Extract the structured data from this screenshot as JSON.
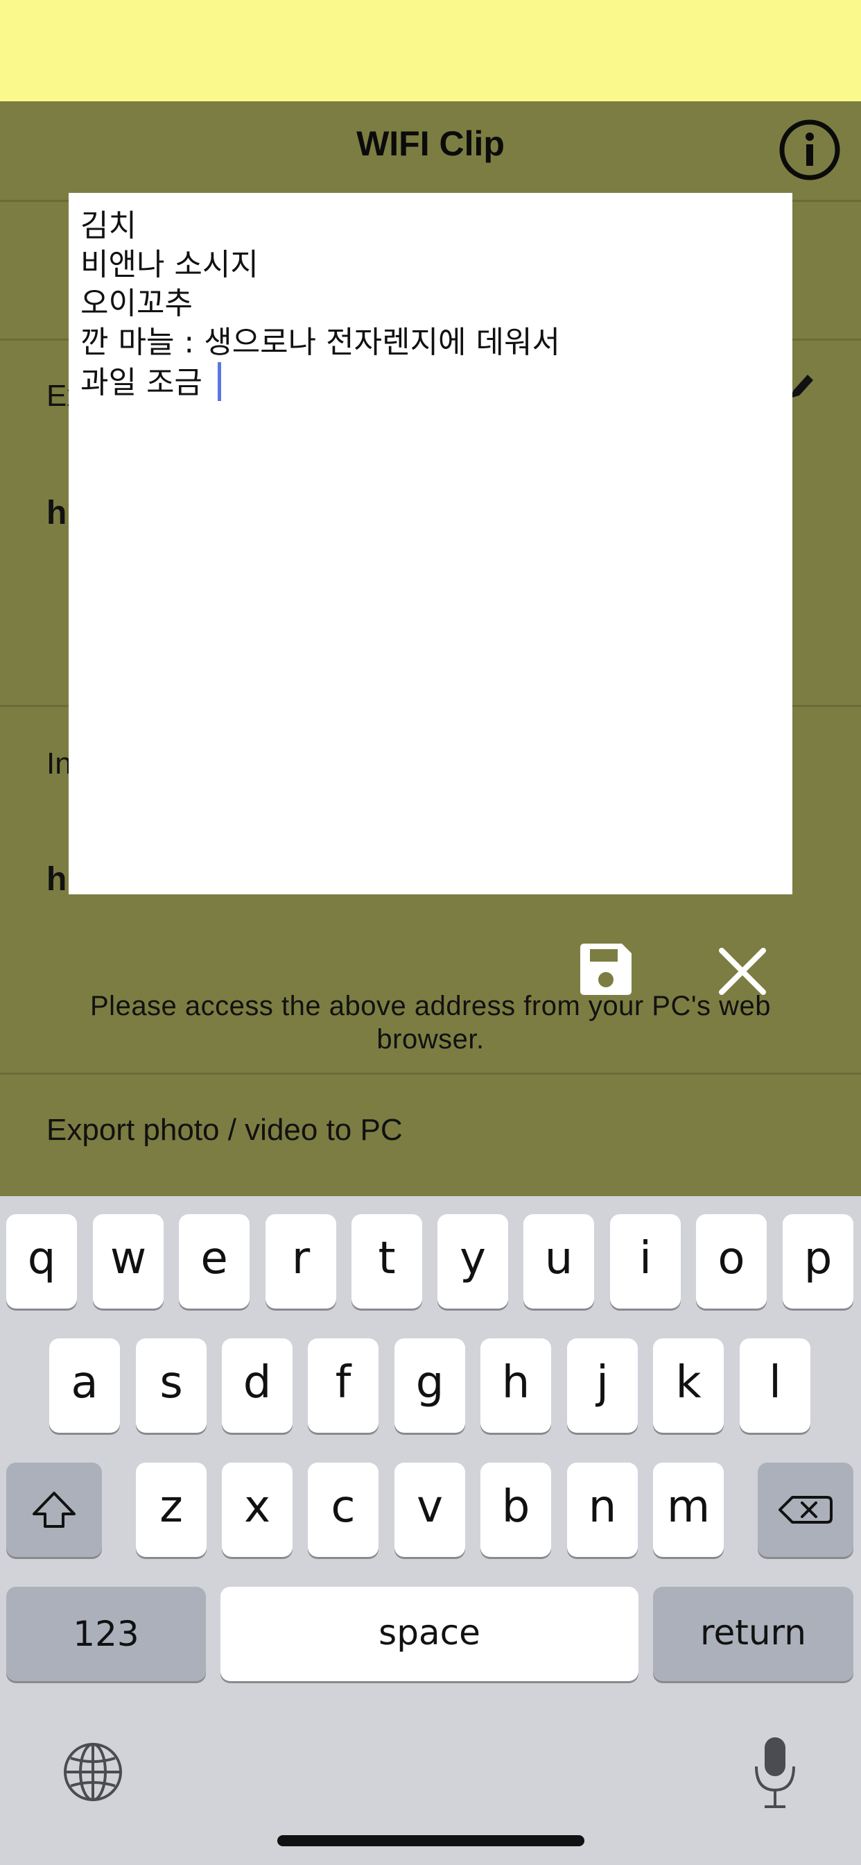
{
  "header": {
    "title": "WIFI Clip"
  },
  "background": {
    "export_label_partial": "Ex",
    "url1_partial": "h",
    "import_label_partial": "In",
    "url2_partial": "h",
    "help_text": "Please access the above address from your PC's web browser.",
    "export_media_label": "Export photo / video to PC"
  },
  "editor": {
    "lines": [
      "김치",
      "비앤나 소시지",
      "오이꼬추",
      "깐 마늘 : 생으로나 전자렌지에 데워서",
      "과일 조금 "
    ]
  },
  "keyboard": {
    "row1": [
      "q",
      "w",
      "e",
      "r",
      "t",
      "y",
      "u",
      "i",
      "o",
      "p"
    ],
    "row2": [
      "a",
      "s",
      "d",
      "f",
      "g",
      "h",
      "j",
      "k",
      "l"
    ],
    "row3": [
      "z",
      "x",
      "c",
      "v",
      "b",
      "n",
      "m"
    ],
    "numbers_key": "123",
    "space_key": "space",
    "return_key": "return"
  },
  "icons": {
    "info": "info-icon",
    "edit": "pencil-icon",
    "save": "floppy-disk-icon",
    "close": "close-icon",
    "shift": "shift-icon",
    "backspace": "backspace-icon",
    "globe": "globe-icon",
    "mic": "microphone-icon"
  },
  "colors": {
    "status_bar": "#f9f98c",
    "app_background": "#7c7d42",
    "editor_background": "#ffffff",
    "cursor": "#5a76e0",
    "keyboard_background": "#d1d3d9"
  }
}
